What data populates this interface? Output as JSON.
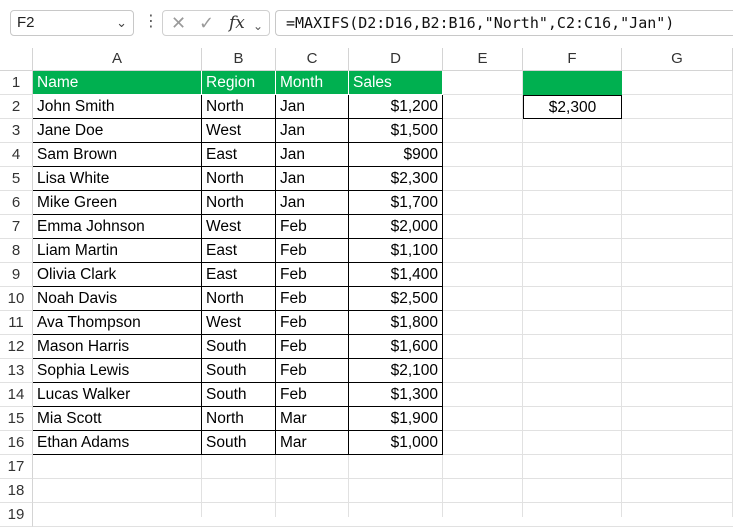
{
  "formula_bar": {
    "name_box": "F2",
    "formula": "=MAXIFS(D2:D16,B2:B16,\"North\",C2:C16,\"Jan\")"
  },
  "columns": [
    "A",
    "B",
    "C",
    "D",
    "E",
    "F",
    "G"
  ],
  "rows": [
    "1",
    "2",
    "3",
    "4",
    "5",
    "6",
    "7",
    "8",
    "9",
    "10",
    "11",
    "12",
    "13",
    "14",
    "15",
    "16",
    "17",
    "18",
    "19"
  ],
  "table": {
    "headers": [
      "Name",
      "Region",
      "Month",
      "Sales"
    ],
    "rows": [
      [
        "John Smith",
        "North",
        "Jan",
        "$1,200"
      ],
      [
        "Jane Doe",
        "West",
        "Jan",
        "$1,500"
      ],
      [
        "Sam Brown",
        "East",
        "Jan",
        "$900"
      ],
      [
        "Lisa White",
        "North",
        "Jan",
        "$2,300"
      ],
      [
        "Mike Green",
        "North",
        "Jan",
        "$1,700"
      ],
      [
        "Emma Johnson",
        "West",
        "Feb",
        "$2,000"
      ],
      [
        "Liam Martin",
        "East",
        "Feb",
        "$1,100"
      ],
      [
        "Olivia Clark",
        "East",
        "Feb",
        "$1,400"
      ],
      [
        "Noah Davis",
        "North",
        "Feb",
        "$2,500"
      ],
      [
        "Ava Thompson",
        "West",
        "Feb",
        "$1,800"
      ],
      [
        "Mason Harris",
        "South",
        "Feb",
        "$1,600"
      ],
      [
        "Sophia Lewis",
        "South",
        "Feb",
        "$2,100"
      ],
      [
        "Lucas Walker",
        "South",
        "Feb",
        "$1,300"
      ],
      [
        "Mia Scott",
        "North",
        "Mar",
        "$1,900"
      ],
      [
        "Ethan Adams",
        "South",
        "Mar",
        "$1,000"
      ]
    ]
  },
  "result": {
    "F1": "",
    "F2": "$2,300"
  },
  "colors": {
    "header_fill": "#00b050",
    "header_text": "#ffffff"
  }
}
